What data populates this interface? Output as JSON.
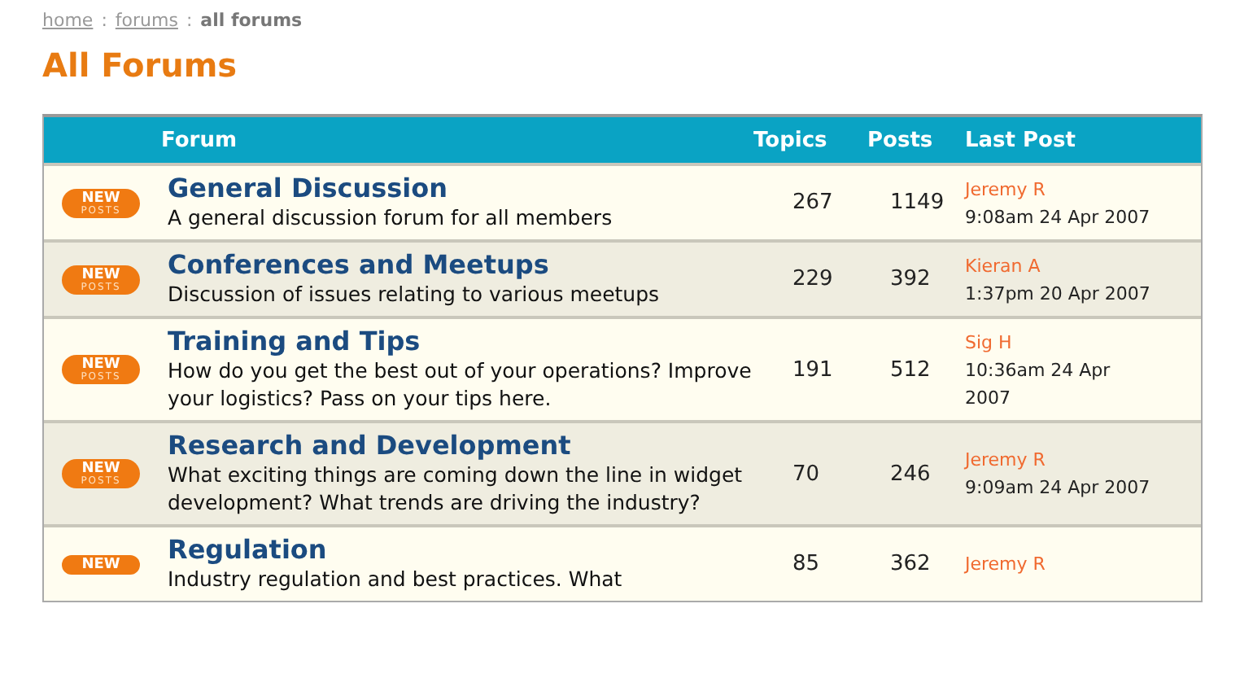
{
  "breadcrumb": {
    "links": [
      "home",
      "forums"
    ],
    "separator": ":",
    "current": "all forums"
  },
  "title": "All Forums",
  "table": {
    "columns": [
      "Forum",
      "Topics",
      "Posts",
      "Last Post"
    ],
    "rows": [
      {
        "badge": {
          "top": "NEW",
          "bottom": "POSTS"
        },
        "name": "General Discussion",
        "description": "A general discussion forum for all members",
        "topics": "267",
        "posts": "1149",
        "last_post": {
          "author": "Jeremy R",
          "time": "9:08am 24 Apr 2007"
        }
      },
      {
        "badge": {
          "top": "NEW",
          "bottom": "POSTS"
        },
        "name": "Conferences and Meetups",
        "description": "Discussion of issues relating to various meetups",
        "topics": "229",
        "posts": "392",
        "last_post": {
          "author": "Kieran A",
          "time": "1:37pm 20 Apr 2007"
        }
      },
      {
        "badge": {
          "top": "NEW",
          "bottom": "POSTS"
        },
        "name": "Training and Tips",
        "description": "How do you get the best out of your operations? Improve your logistics? Pass on your tips here.",
        "topics": "191",
        "posts": "512",
        "last_post": {
          "author": "Sig H",
          "time": "10:36am 24 Apr 2007"
        }
      },
      {
        "badge": {
          "top": "NEW",
          "bottom": "POSTS"
        },
        "name": "Research and Development",
        "description": "What exciting things are coming down the line in widget development? What trends are driving the industry?",
        "topics": "70",
        "posts": "246",
        "last_post": {
          "author": "Jeremy R",
          "time": "9:09am 24 Apr 2007"
        }
      },
      {
        "badge": {
          "top": "NEW"
        },
        "name": "Regulation",
        "description": "Industry regulation and best practices. What",
        "topics": "85",
        "posts": "362",
        "last_post": {
          "author": "Jeremy R"
        }
      }
    ]
  }
}
